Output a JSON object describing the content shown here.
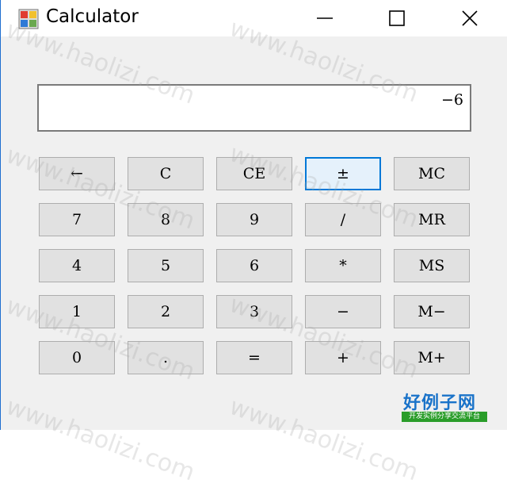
{
  "window": {
    "title": "Calculator",
    "icon": "calculator-app-icon",
    "controls": {
      "minimize_icon": "minimize-icon",
      "maximize_icon": "maximize-icon",
      "close_icon": "close-icon"
    }
  },
  "display": {
    "value": "−6"
  },
  "keypad": {
    "rows": [
      [
        "←",
        "C",
        "CE",
        "±",
        "MC"
      ],
      [
        "7",
        "8",
        "9",
        "/",
        "MR"
      ],
      [
        "4",
        "5",
        "6",
        "*",
        "MS"
      ],
      [
        "1",
        "2",
        "3",
        "−",
        "M−"
      ],
      [
        "0",
        ".",
        "=",
        "+",
        "M+"
      ]
    ],
    "focused_key": "±"
  },
  "watermark": {
    "text": "www.haolizi.com"
  },
  "site_logo": {
    "title": "好例子网",
    "subtitle": "开发实例分享交流平台"
  },
  "colors": {
    "focus_border": "#0078d7",
    "focus_fill": "#e5f1fb",
    "window_border": "#1f6fd0",
    "logo_blue": "#1a73c9",
    "logo_green": "#2a9d2a"
  }
}
